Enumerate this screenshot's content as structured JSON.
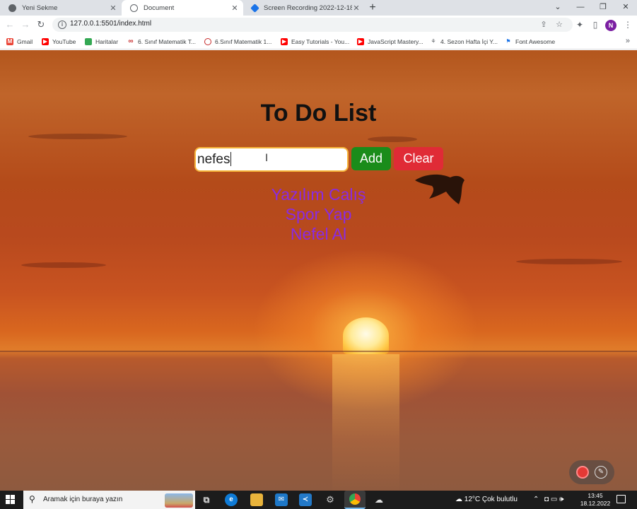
{
  "browser": {
    "tabs": [
      {
        "title": "Yeni Sekme",
        "active": false,
        "icon_color": "#5f6368"
      },
      {
        "title": "Document",
        "active": true,
        "icon_color": "#5f6368"
      },
      {
        "title": "Screen Recording 2022-12-18...",
        "active": false,
        "icon_color": "#1a73e8"
      }
    ],
    "new_tab": "+",
    "window_controls": {
      "tab_search": "⌄",
      "minimize": "—",
      "restore": "❐",
      "close": "✕"
    },
    "nav": {
      "back": "←",
      "forward": "→",
      "reload": "↻"
    },
    "url": "127.0.0.1:5501/index.html",
    "profile_initial": "N",
    "bookmarks": [
      {
        "label": "Gmail",
        "icon": "gmail-icon",
        "color": "#ea4335"
      },
      {
        "label": "YouTube",
        "icon": "youtube-icon",
        "color": "#ff0000"
      },
      {
        "label": "Haritalar",
        "icon": "maps-icon",
        "color": "#34a853"
      },
      {
        "label": "6. Sınıf Matematik T...",
        "icon": "infinity-icon",
        "color": "#c62828"
      },
      {
        "label": "6.Sınıf Matematik 1...",
        "icon": "compass-icon",
        "color": "#c62828"
      },
      {
        "label": "Easy Tutorials - You...",
        "icon": "youtube-icon",
        "color": "#ff0000"
      },
      {
        "label": "JavaScript Mastery...",
        "icon": "youtube-icon",
        "color": "#ff0000"
      },
      {
        "label": "4. Sezon Hafta İçi Y...",
        "icon": "tv-icon",
        "color": "#5f6368"
      },
      {
        "label": "Font Awesome",
        "icon": "flag-icon",
        "color": "#1a73e8"
      }
    ],
    "bookmarks_more": "»"
  },
  "page": {
    "title": "To Do List",
    "input_value": "nefes ",
    "add_label": "Add",
    "clear_label": "Clear",
    "items": [
      "Yazılım Calış",
      "Spor Yap",
      "Nefel Al"
    ],
    "colors": {
      "item_text": "#8a2be2",
      "add_bg": "#1a8c1a",
      "clear_bg": "#e02b36",
      "input_border": "#f6b43b"
    }
  },
  "taskbar": {
    "search_placeholder": "Aramak için buraya yazın",
    "weather": "12°C  Çok bulutlu",
    "time": "13:45",
    "date": "18.12.2022"
  }
}
